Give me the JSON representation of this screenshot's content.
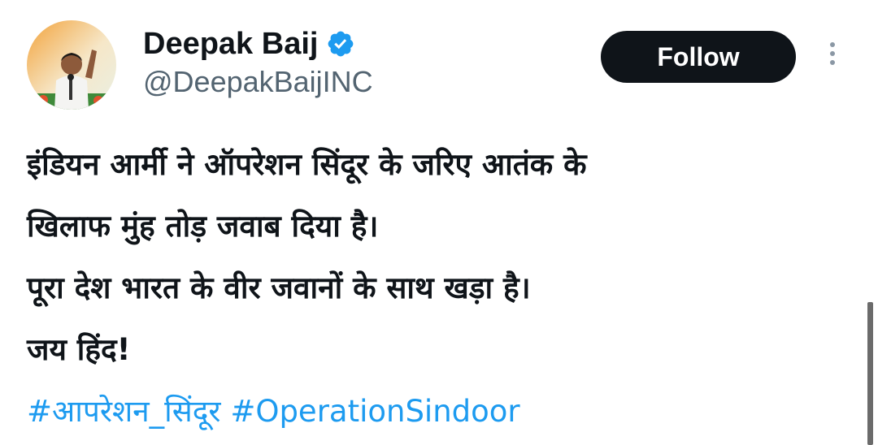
{
  "author": {
    "display_name": "Deepak Baij",
    "handle": "@DeepakBaijINC",
    "verified": true,
    "avatar_icon": "profile-photo"
  },
  "actions": {
    "follow_label": "Follow",
    "more_icon": "more-vertical-icon"
  },
  "tweet": {
    "lines": [
      "इंडियन आर्मी ने ऑपरेशन सिंदूर के जरिए आतंक के",
      "खिलाफ मुंह तोड़ जवाब दिया है।",
      "पूरा देश भारत के वीर जवानों के साथ खड़ा है।",
      "जय हिंद!"
    ],
    "hashtags": [
      "#आपरेशन_सिंदूर",
      "#OperationSindoor"
    ]
  },
  "colors": {
    "text": "#0f1419",
    "secondary_text": "#536471",
    "link": "#1d9bf0",
    "verified_badge": "#1d9bf0",
    "follow_button_bg": "#0f1419",
    "follow_button_text": "#ffffff"
  }
}
